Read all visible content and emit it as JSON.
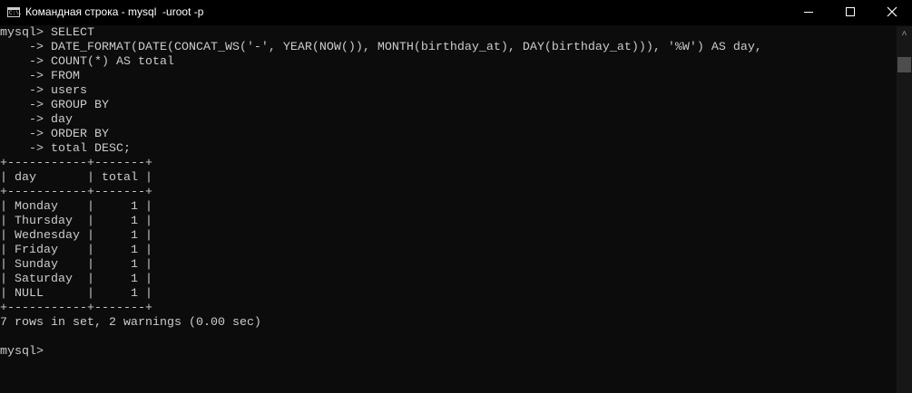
{
  "window": {
    "title": "Командная строка - mysql  -uroot -p",
    "icon_text": "C:\\."
  },
  "console": {
    "lines": [
      "mysql> SELECT",
      "    -> DATE_FORMAT(DATE(CONCAT_WS('-', YEAR(NOW()), MONTH(birthday_at), DAY(birthday_at))), '%W') AS day,",
      "    -> COUNT(*) AS total",
      "    -> FROM",
      "    -> users",
      "    -> GROUP BY",
      "    -> day",
      "    -> ORDER BY",
      "    -> total DESC;",
      "+-----------+-------+",
      "| day       | total |",
      "+-----------+-------+",
      "| Monday    |     1 |",
      "| Thursday  |     1 |",
      "| Wednesday |     1 |",
      "| Friday    |     1 |",
      "| Sunday    |     1 |",
      "| Saturday  |     1 |",
      "| NULL      |     1 |",
      "+-----------+-------+",
      "7 rows in set, 2 warnings (0.00 sec)",
      "",
      "mysql> "
    ]
  },
  "scrollbar": {
    "position": 0.0
  }
}
